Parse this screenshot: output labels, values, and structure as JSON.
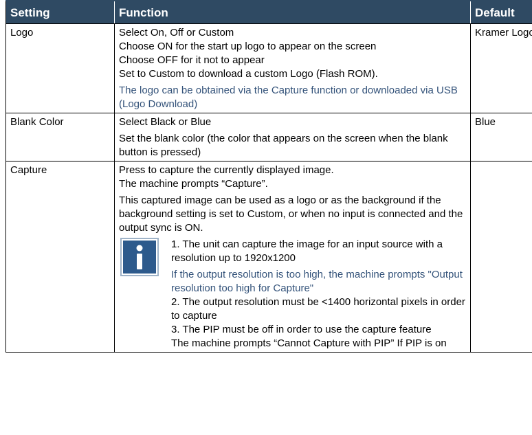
{
  "table": {
    "headers": [
      "Setting",
      "Function",
      "Default"
    ],
    "rows": [
      {
        "setting": "Logo",
        "function_lines": [
          "Select On, Off or Custom",
          "Choose ON for the start up logo to appear on the screen",
          "Choose OFF for it not to appear",
          "Set to Custom to download a custom Logo (Flash ROM)."
        ],
        "note": "The logo can be obtained via the Capture function or downloaded via USB (Logo Download)",
        "default": "Kramer Logo"
      },
      {
        "setting": "Blank Color",
        "function_lines": [
          "Select Black or Blue",
          "Set the blank color (the color that appears on the screen when the blank button is pressed)"
        ],
        "default": "Blue"
      },
      {
        "setting": "Capture",
        "function_lines": [
          "Press to capture the currently displayed image.",
          "The machine prompts “Capture”.",
          "This captured image can be used as a logo or as the background if the background setting is set to Custom, or when no input is connected and the output sync is ON."
        ],
        "info_box": {
          "icon": "info-icon",
          "line1": "1. The unit can capture the image for an input source with a resolution up to 1920x1200",
          "note": "If the output resolution is too high, the machine prompts \"Output resolution too high for Capture\"",
          "line2": "2. The output resolution must be <1400 horizontal pixels in order to capture",
          "line3": "3. The PIP must be off in order to use the capture feature",
          "line4": "The machine prompts “Cannot Capture with PIP” If PIP is on"
        },
        "default": ""
      }
    ]
  },
  "colors": {
    "header_bg": "#2f4a63",
    "note_text": "#34537a",
    "icon_blue": "#2d5a8c"
  }
}
